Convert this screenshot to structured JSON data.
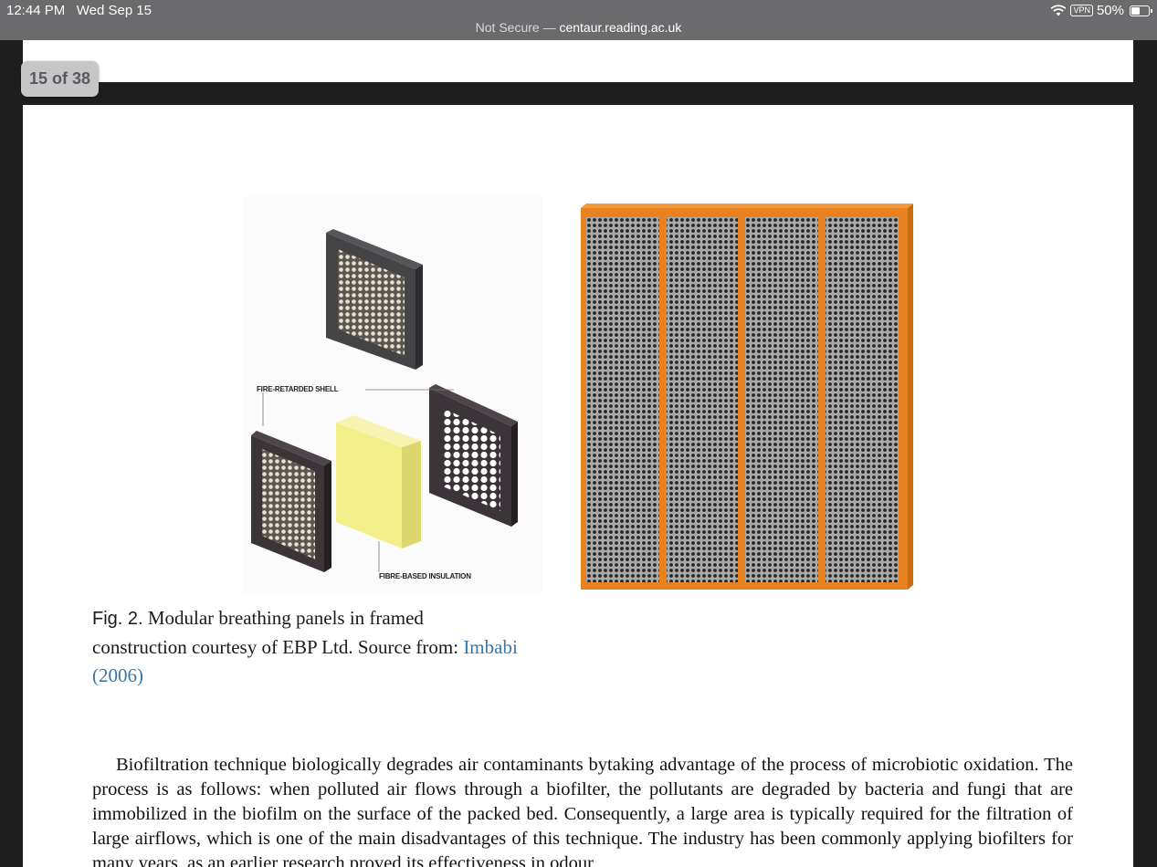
{
  "status_bar": {
    "time": "12:44 PM",
    "date": "Wed Sep 15",
    "vpn": "VPN",
    "battery": "50%",
    "battery_level": 0.5
  },
  "address_bar": {
    "security": "Not Secure",
    "separator": " — ",
    "host": "centaur.reading.ac.uk"
  },
  "viewer": {
    "page_counter": "15 of 38"
  },
  "figure": {
    "label_shell": "FIRE-RETARDED SHELL",
    "label_insulation": "FIBRE-BASED INSULATION",
    "caption_label": "Fig. 2.",
    "caption_text": " Modular breathing panels in framed construction courtesy of EBP Ltd. Source  from: ",
    "caption_citation": "Imbabi (2006)"
  },
  "body": {
    "paragraph": "Biofiltration technique biologically degrades air contaminants bytaking advantage of the process of microbiotic oxidation. The process is as follows: when polluted air flows through a biofilter, the pollutants are degraded by bacteria and fungi that are immobilized in the biofilm on the surface of the packed bed. Consequently, a large area is typically required for the filtration of large airflows, which is one of the main disadvantages of this technique. The industry has been commonly applying biofilters for many years, as an earlier research proved its effectiveness in odour"
  },
  "colors": {
    "frame_orange": "#e8821e",
    "panel_grey": "#8a8a8a",
    "link_blue": "#3a76a6"
  }
}
